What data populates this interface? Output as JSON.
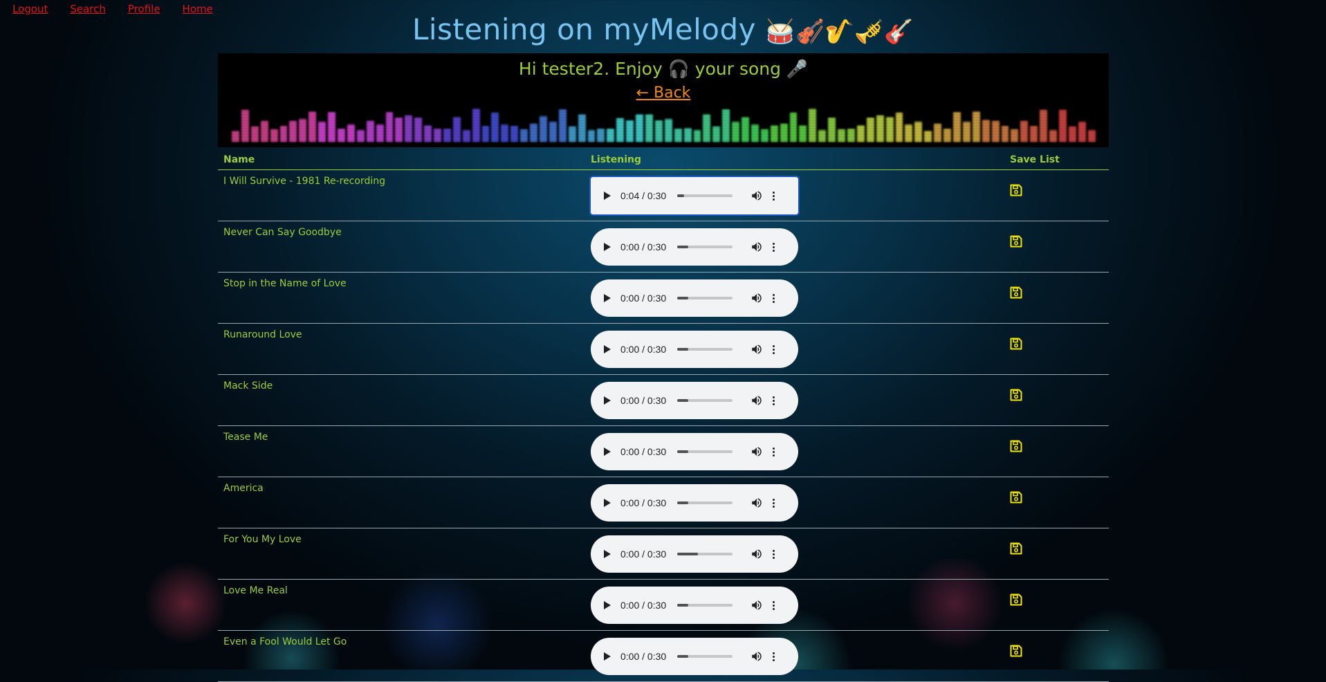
{
  "nav": {
    "links": [
      "Logout",
      "Search",
      "Profile",
      "Home"
    ]
  },
  "header": {
    "title": "Listening on myMelody",
    "emojis": "🥁🎻🎷🎺🎸"
  },
  "banner": {
    "greeting": "Hi tester2. Enjoy 🎧 your song 🎤",
    "back_label": "← Back"
  },
  "table": {
    "columns": [
      "Name",
      "Listening",
      "Save List"
    ],
    "rows": [
      {
        "name": "I Will Survive - 1981 Re-recording",
        "time": "0:04 / 0:30",
        "progress": 0.13
      },
      {
        "name": "Never Can Say Goodbye",
        "time": "0:00 / 0:30",
        "progress": 0.2
      },
      {
        "name": "Stop in the Name of Love",
        "time": "0:00 / 0:30",
        "progress": 0.2
      },
      {
        "name": "Runaround Love",
        "time": "0:00 / 0:30",
        "progress": 0.2
      },
      {
        "name": "Mack Side",
        "time": "0:00 / 0:30",
        "progress": 0.2
      },
      {
        "name": "Tease Me",
        "time": "0:00 / 0:30",
        "progress": 0.2
      },
      {
        "name": "America",
        "time": "0:00 / 0:30",
        "progress": 0.2
      },
      {
        "name": "For You My Love",
        "time": "0:00 / 0:30",
        "progress": 0.38
      },
      {
        "name": "Love Me Real",
        "time": "0:00 / 0:30",
        "progress": 0.2
      },
      {
        "name": "Even a Fool Would Let Go",
        "time": "0:00 / 0:30",
        "progress": 0.2
      }
    ]
  },
  "icons": {
    "save": "floppy-disk-icon",
    "play": "play-icon",
    "volume": "volume-icon",
    "menu": "more-vert-icon"
  },
  "colors": {
    "link_red": "#e0141b",
    "title_blue": "#79c3f0",
    "text_green": "#9ccd3a",
    "back_orange": "#ee8a1a",
    "save_yellow": "#f2e500"
  }
}
